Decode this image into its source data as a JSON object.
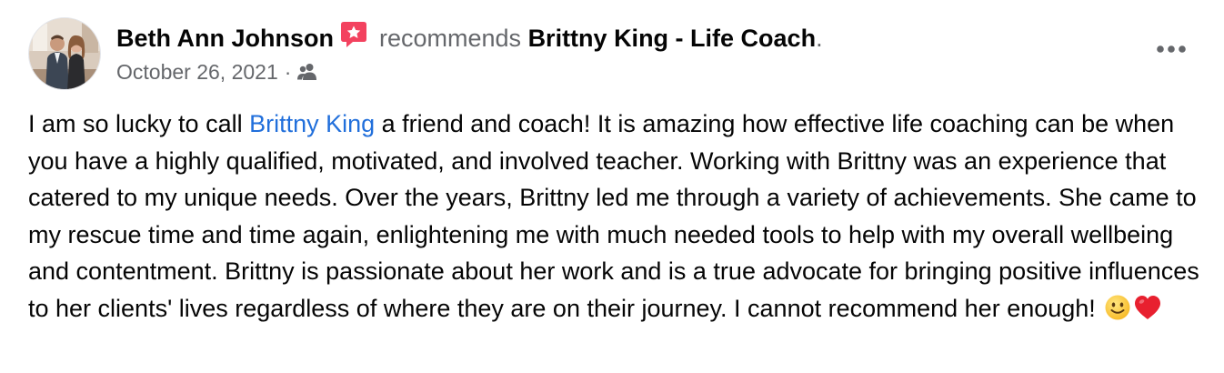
{
  "post": {
    "author_name": "Beth Ann Johnson",
    "badge_icon": "recommendation-star-icon",
    "action_text": "recommends",
    "page_name": "Brittny King - Life Coach",
    "page_name_suffix": ".",
    "date": "October 26, 2021",
    "date_separator": "·",
    "audience_icon": "friends-icon",
    "more_icon": "more-options-icon",
    "text_before_mention": "I am so lucky to call ",
    "mention": "Brittny King",
    "text_after_mention": " a friend and coach! It is amazing how effective life coaching can be when you have a highly qualified, motivated, and involved teacher. Working with Brittny was an experience that catered to my unique needs. Over the years, Brittny led me through a variety of achievements. She came to my rescue time and time again, enlightening me with much needed tools to help with my overall wellbeing and contentment. Brittny is passionate about her work and is a true advocate for bringing positive influences to her clients' lives regardless of where they are on their journey. I cannot recommend her enough! ",
    "emojis": [
      "slightly-smiling-face-emoji",
      "red-heart-emoji"
    ]
  },
  "colors": {
    "primary_text": "#050505",
    "secondary_text": "#65676b",
    "link": "#216fdb",
    "badge": "#f3425f"
  }
}
